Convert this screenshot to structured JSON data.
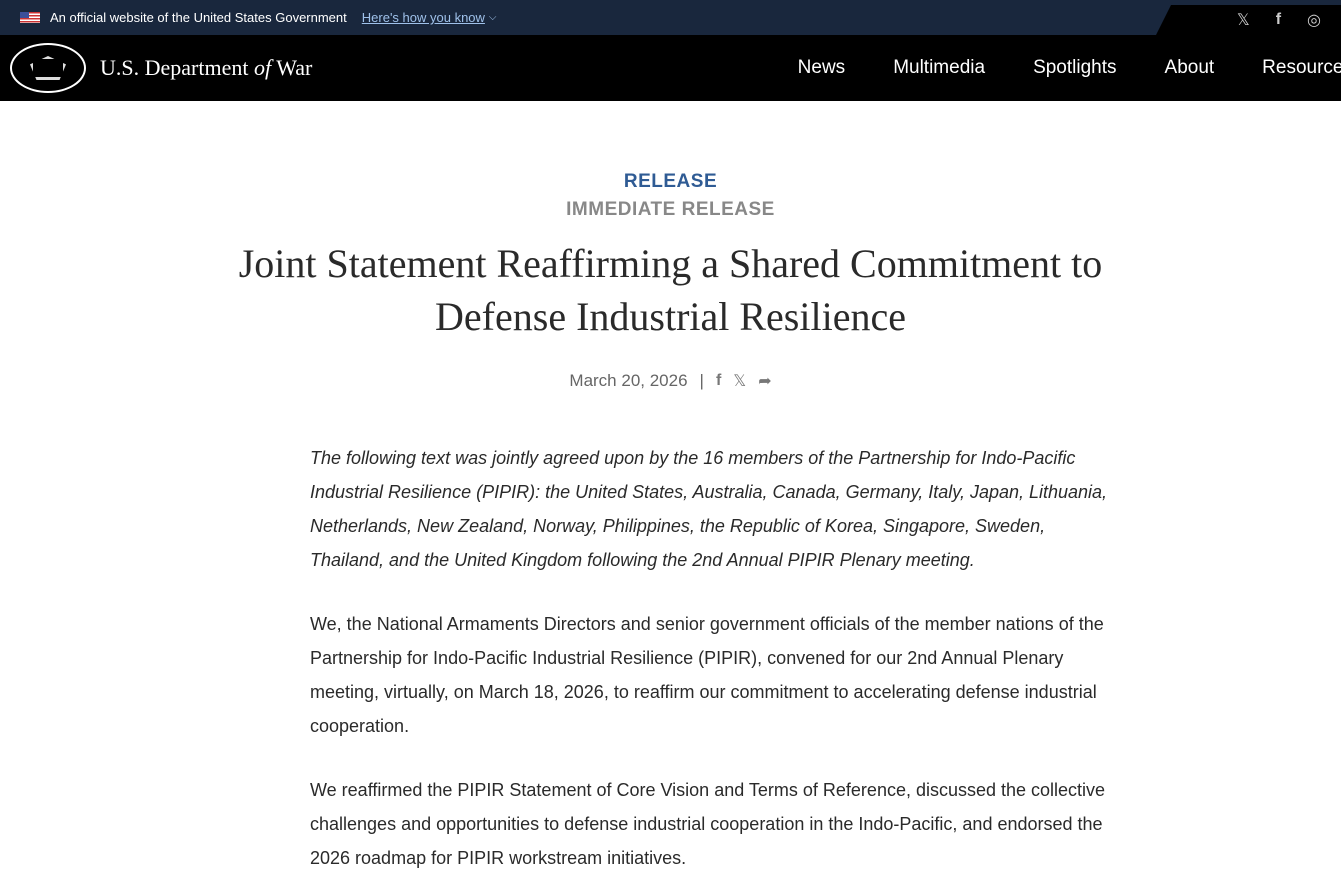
{
  "gov_banner": {
    "text": "An official website of the United States Government",
    "link": "Here's how you know"
  },
  "social": {
    "x": "𝕏",
    "facebook": "f",
    "instagram": "◎"
  },
  "brand": {
    "pre": "U.S. Department ",
    "of": "of",
    "post": " War"
  },
  "nav": [
    "News",
    "Multimedia",
    "Spotlights",
    "About",
    "Resources"
  ],
  "article": {
    "kind": "RELEASE",
    "subkind": "IMMEDIATE RELEASE",
    "title": "Joint Statement Reaffirming a Shared Commitment to Defense Industrial Resilience",
    "date": "March 20, 2026",
    "sep": "|",
    "share": {
      "facebook": "f",
      "x": "𝕏",
      "share": "➦"
    },
    "paragraphs": [
      "The following text was jointly agreed upon by the 16 members of the Partnership for Indo-Pacific Industrial Resilience (PIPIR): the United States, Australia, Canada, Germany, Italy, Japan, Lithuania, Netherlands, New Zealand, Norway, Philippines, the Republic of Korea, Singapore, Sweden, Thailand, and the United Kingdom following the 2nd Annual PIPIR Plenary meeting.",
      "We, the National Armaments Directors and senior government officials of the member nations of the Partnership for Indo-Pacific Industrial Resilience (PIPIR), convened for our 2nd Annual Plenary meeting, virtually, on March 18, 2026, to reaffirm our commitment to accelerating defense industrial cooperation.",
      "We reaffirmed the PIPIR Statement of Core Vision and Terms of Reference, discussed the collective challenges and opportunities to defense industrial cooperation in the Indo-Pacific, and endorsed the 2026 roadmap for PIPIR workstream initiatives."
    ]
  }
}
